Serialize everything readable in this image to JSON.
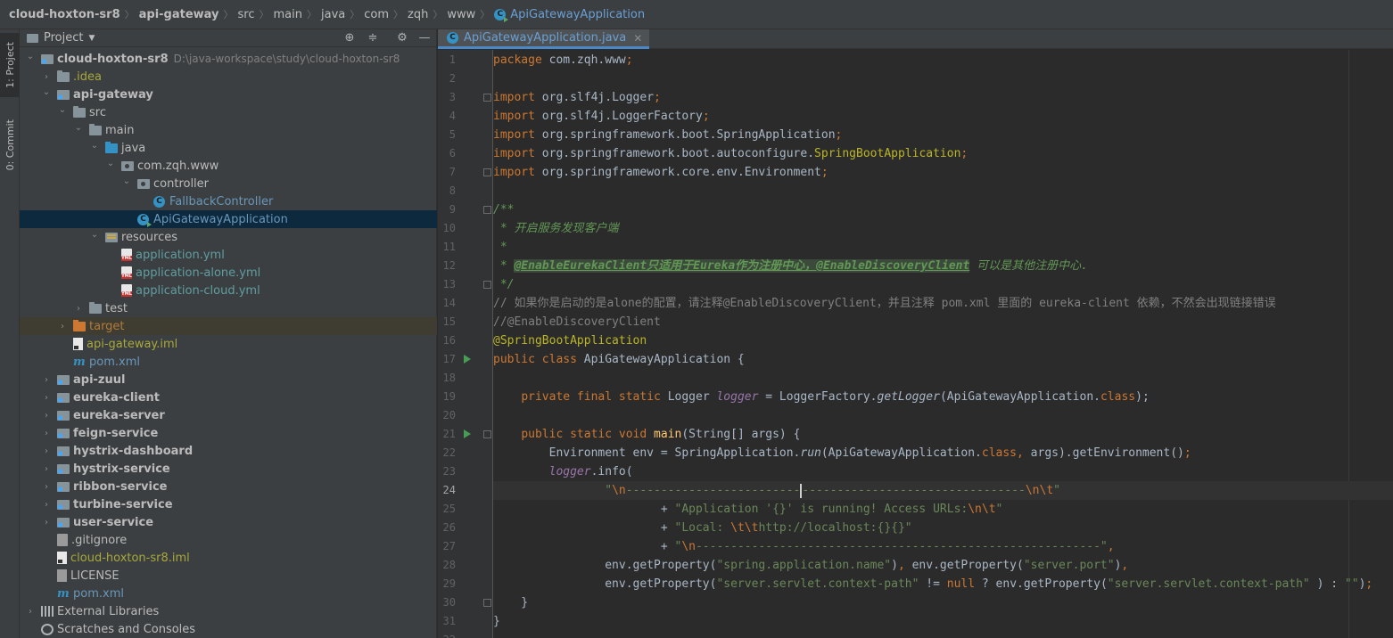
{
  "breadcrumb": [
    {
      "label": "cloud-hoxton-sr8",
      "bold": true
    },
    {
      "label": "api-gateway",
      "bold": true
    },
    {
      "label": "src"
    },
    {
      "label": "main"
    },
    {
      "label": "java"
    },
    {
      "label": "com"
    },
    {
      "label": "zqh"
    },
    {
      "label": "www"
    },
    {
      "label": "ApiGatewayApplication",
      "icon": "class-icon"
    }
  ],
  "tool_stripe": {
    "project": "1: Project",
    "commit": "0: Commit"
  },
  "project_panel": {
    "title": "Project",
    "tree": [
      {
        "label": "cloud-hoxton-sr8",
        "path": "D:\\java-workspace\\study\\cloud-hoxton-sr8",
        "depth": 0,
        "arrow": "expanded",
        "icon": "module",
        "style": "bold"
      },
      {
        "label": ".idea",
        "depth": 1,
        "arrow": "collapsed",
        "icon": "folder",
        "style": "yellow"
      },
      {
        "label": "api-gateway",
        "depth": 1,
        "arrow": "expanded",
        "icon": "module",
        "style": "bold"
      },
      {
        "label": "src",
        "depth": 2,
        "arrow": "expanded",
        "icon": "folder"
      },
      {
        "label": "main",
        "depth": 3,
        "arrow": "expanded",
        "icon": "folder"
      },
      {
        "label": "java",
        "depth": 4,
        "arrow": "expanded",
        "icon": "src"
      },
      {
        "label": "com.zqh.www",
        "depth": 5,
        "arrow": "expanded",
        "icon": "pkg"
      },
      {
        "label": "controller",
        "depth": 6,
        "arrow": "expanded",
        "icon": "pkg"
      },
      {
        "label": "FallbackController",
        "depth": 7,
        "arrow": "none",
        "icon": "class",
        "style": "blue"
      },
      {
        "label": "ApiGatewayApplication",
        "depth": 6,
        "arrow": "none",
        "icon": "class-run",
        "style": "blue",
        "selected": true
      },
      {
        "label": "resources",
        "depth": 4,
        "arrow": "expanded",
        "icon": "res"
      },
      {
        "label": "application.yml",
        "depth": 5,
        "arrow": "none",
        "icon": "yml",
        "style": "green"
      },
      {
        "label": "application-alone.yml",
        "depth": 5,
        "arrow": "none",
        "icon": "yml",
        "style": "green"
      },
      {
        "label": "application-cloud.yml",
        "depth": 5,
        "arrow": "none",
        "icon": "yml",
        "style": "green"
      },
      {
        "label": "test",
        "depth": 3,
        "arrow": "collapsed",
        "icon": "folder"
      },
      {
        "label": "target",
        "depth": 2,
        "arrow": "collapsed",
        "icon": "target",
        "style": "target",
        "excluded": true
      },
      {
        "label": "api-gateway.iml",
        "depth": 2,
        "arrow": "none",
        "icon": "iml",
        "style": "yellow"
      },
      {
        "label": "pom.xml",
        "depth": 2,
        "arrow": "none",
        "icon": "pom",
        "style": "blue"
      },
      {
        "label": "api-zuul",
        "depth": 1,
        "arrow": "collapsed",
        "icon": "module",
        "style": "bold"
      },
      {
        "label": "eureka-client",
        "depth": 1,
        "arrow": "collapsed",
        "icon": "module",
        "style": "bold"
      },
      {
        "label": "eureka-server",
        "depth": 1,
        "arrow": "collapsed",
        "icon": "module",
        "style": "bold"
      },
      {
        "label": "feign-service",
        "depth": 1,
        "arrow": "collapsed",
        "icon": "module",
        "style": "bold"
      },
      {
        "label": "hystrix-dashboard",
        "depth": 1,
        "arrow": "collapsed",
        "icon": "module",
        "style": "bold"
      },
      {
        "label": "hystrix-service",
        "depth": 1,
        "arrow": "collapsed",
        "icon": "module",
        "style": "bold"
      },
      {
        "label": "ribbon-service",
        "depth": 1,
        "arrow": "collapsed",
        "icon": "module",
        "style": "bold"
      },
      {
        "label": "turbine-service",
        "depth": 1,
        "arrow": "collapsed",
        "icon": "module",
        "style": "bold"
      },
      {
        "label": "user-service",
        "depth": 1,
        "arrow": "collapsed",
        "icon": "module",
        "style": "bold"
      },
      {
        "label": ".gitignore",
        "depth": 1,
        "arrow": "none",
        "icon": "git"
      },
      {
        "label": "cloud-hoxton-sr8.iml",
        "depth": 1,
        "arrow": "none",
        "icon": "iml",
        "style": "yellow"
      },
      {
        "label": "LICENSE",
        "depth": 1,
        "arrow": "none",
        "icon": "text"
      },
      {
        "label": "pom.xml",
        "depth": 1,
        "arrow": "none",
        "icon": "pom",
        "style": "blue"
      },
      {
        "label": "External Libraries",
        "depth": 0,
        "arrow": "collapsed",
        "icon": "lib"
      },
      {
        "label": "Scratches and Consoles",
        "depth": 0,
        "arrow": "none",
        "icon": "scratch"
      }
    ]
  },
  "editor": {
    "tab_label": "ApiGatewayApplication.java",
    "current_line": 24,
    "run_lines": [
      17,
      21
    ],
    "fold_lines": [
      3,
      7,
      9,
      13,
      21,
      30
    ],
    "lines": [
      [
        [
          "kw",
          "package "
        ],
        [
          "",
          "com.zqh.www"
        ],
        [
          "kw",
          ";"
        ]
      ],
      [],
      [
        [
          "kw",
          "import "
        ],
        [
          "",
          "org.slf4j.Logger"
        ],
        [
          "kw",
          ";"
        ]
      ],
      [
        [
          "kw",
          "import "
        ],
        [
          "",
          "org.slf4j.LoggerFactory"
        ],
        [
          "kw",
          ";"
        ]
      ],
      [
        [
          "kw",
          "import "
        ],
        [
          "",
          "org.springframework.boot.SpringApplication"
        ],
        [
          "kw",
          ";"
        ]
      ],
      [
        [
          "kw",
          "import "
        ],
        [
          "",
          "org.springframework.boot.autoconfigure."
        ],
        [
          "ann",
          "SpringBootApplication"
        ],
        [
          "kw",
          ";"
        ]
      ],
      [
        [
          "kw",
          "import "
        ],
        [
          "",
          "org.springframework.core.env.Environment"
        ],
        [
          "kw",
          ";"
        ]
      ],
      [],
      [
        [
          "doc",
          "/**"
        ]
      ],
      [
        [
          "doc",
          " * 开启服务发现客户端"
        ]
      ],
      [
        [
          "doc",
          " *"
        ]
      ],
      [
        [
          "doc",
          " * "
        ],
        [
          "doctag",
          "@EnableEurekaClient只适用于Eureka作为注册中心，@EnableDiscoveryClient"
        ],
        [
          "doc",
          " 可以是其他注册中心."
        ]
      ],
      [
        [
          "doc",
          " */"
        ]
      ],
      [
        [
          "cm",
          "// 如果你是启动的是alone的配置，请注释@EnableDiscoveryClient，并且注释 pom.xml 里面的 eureka-client 依赖，不然会出现链接错误"
        ]
      ],
      [
        [
          "cm",
          "//@EnableDiscoveryClient"
        ]
      ],
      [
        [
          "ann",
          "@SpringBootApplication"
        ]
      ],
      [
        [
          "kw",
          "public class "
        ],
        [
          "",
          "ApiGatewayApplication {"
        ]
      ],
      [],
      [
        [
          "",
          "    "
        ],
        [
          "kw",
          "private final static "
        ],
        [
          "",
          "Logger "
        ],
        [
          "fld",
          "logger"
        ],
        [
          "",
          " = LoggerFactory."
        ],
        [
          "stc",
          "getLogger"
        ],
        [
          "",
          "(ApiGatewayApplication."
        ],
        [
          "kw",
          "class"
        ],
        [
          "",
          ");"
        ]
      ],
      [],
      [
        [
          "",
          "    "
        ],
        [
          "kw",
          "public static void "
        ],
        [
          "mth",
          "main"
        ],
        [
          "",
          "(String[] args) {"
        ]
      ],
      [
        [
          "",
          "        Environment env = SpringApplication."
        ],
        [
          "stc",
          "run"
        ],
        [
          "",
          "(ApiGatewayApplication."
        ],
        [
          "kw",
          "class"
        ],
        [
          "kw",
          ", "
        ],
        [
          "",
          "args).getEnvironment()"
        ],
        [
          "kw",
          ";"
        ]
      ],
      [
        [
          "",
          "        "
        ],
        [
          "fld",
          "logger"
        ],
        [
          "",
          ".info("
        ]
      ],
      [
        [
          "",
          "                "
        ],
        [
          "str",
          "\""
        ],
        [
          "esc",
          "\\n"
        ],
        [
          "str",
          "-------------------------"
        ],
        [
          "caret",
          ""
        ],
        [
          "str",
          "--------------------------------"
        ],
        [
          "esc",
          "\\n\\t"
        ],
        [
          "str",
          "\""
        ]
      ],
      [
        [
          "",
          "                        + "
        ],
        [
          "str",
          "\"Application '{}' is running! Access URLs:"
        ],
        [
          "esc",
          "\\n\\t"
        ],
        [
          "str",
          "\""
        ]
      ],
      [
        [
          "",
          "                        + "
        ],
        [
          "str",
          "\"Local: "
        ],
        [
          "esc",
          "\\t\\t"
        ],
        [
          "str",
          "http://localhost:{}{}\""
        ]
      ],
      [
        [
          "",
          "                        + "
        ],
        [
          "str",
          "\""
        ],
        [
          "esc",
          "\\n"
        ],
        [
          "str",
          "----------------------------------------------------------\""
        ],
        [
          "kw",
          ","
        ]
      ],
      [
        [
          "",
          "                env.getProperty("
        ],
        [
          "str",
          "\"spring.application.name\""
        ],
        [
          "",
          ")"
        ],
        [
          "kw",
          ", "
        ],
        [
          "",
          "env.getProperty("
        ],
        [
          "str",
          "\"server.port\""
        ],
        [
          "",
          ")"
        ],
        [
          "kw",
          ","
        ]
      ],
      [
        [
          "",
          "                env.getProperty("
        ],
        [
          "str",
          "\"server.servlet.context-path\""
        ],
        [
          "",
          " != "
        ],
        [
          "kw",
          "null "
        ],
        [
          "",
          "? env.getProperty("
        ],
        [
          "str",
          "\"server.servlet.context-path\""
        ],
        [
          "",
          " ) : "
        ],
        [
          "str",
          "\"\""
        ],
        [
          "",
          ")"
        ],
        [
          "kw",
          ";"
        ]
      ],
      [
        [
          "",
          "    }"
        ]
      ],
      [
        [
          "",
          "}"
        ]
      ],
      []
    ]
  }
}
